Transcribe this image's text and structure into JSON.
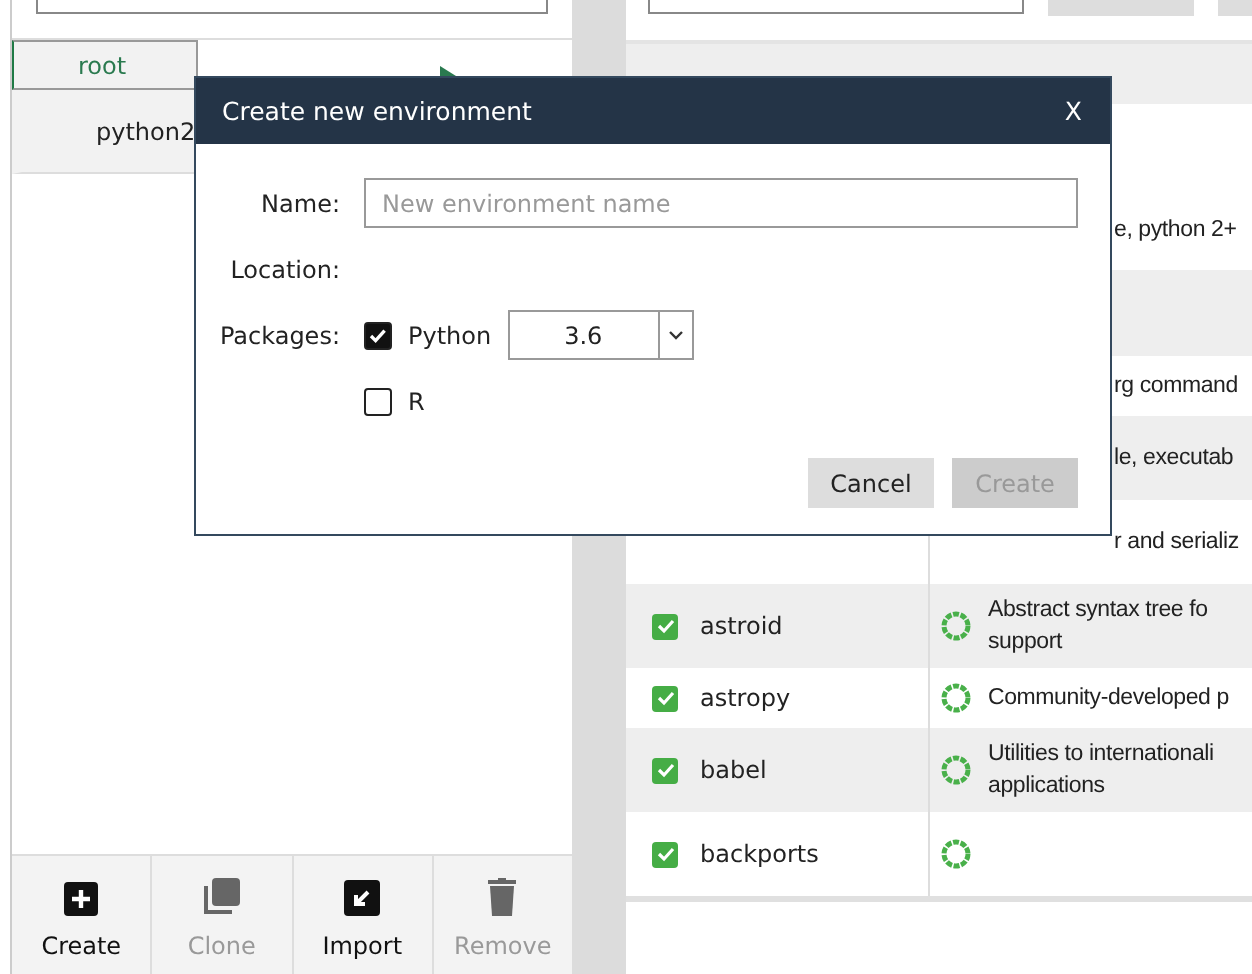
{
  "environments": [
    {
      "name": "root",
      "selected": true
    },
    {
      "name": "python2",
      "selected": false
    }
  ],
  "toolbar": [
    {
      "label": "Create",
      "disabled": false
    },
    {
      "label": "Clone",
      "disabled": true
    },
    {
      "label": "Import",
      "disabled": false
    },
    {
      "label": "Remove",
      "disabled": true
    }
  ],
  "table": {
    "rows": [
      {
        "kind": "covered",
        "description": [
          "e, python 2+"
        ]
      },
      {
        "kind": "covered",
        "description": []
      },
      {
        "kind": "covered",
        "description": [
          "rg command"
        ]
      },
      {
        "kind": "covered",
        "description": [
          "le, executab"
        ]
      },
      {
        "kind": "covered",
        "description": [
          "r and serializ"
        ]
      },
      {
        "kind": "full",
        "name": "astroid",
        "checked": true,
        "description": [
          "Abstract syntax tree fo",
          "support"
        ]
      },
      {
        "kind": "full",
        "name": "astropy",
        "checked": true,
        "description": [
          "Community-developed p"
        ]
      },
      {
        "kind": "full",
        "name": "babel",
        "checked": true,
        "description": [
          "Utilities to internationali",
          "applications"
        ]
      },
      {
        "kind": "full",
        "name": "backports",
        "checked": true,
        "description": []
      }
    ]
  },
  "dialog": {
    "title": "Create new environment",
    "close": "X",
    "name_label": "Name:",
    "name_placeholder": "New environment name",
    "location_label": "Location:",
    "packages_label": "Packages:",
    "packages": [
      {
        "kind": "select",
        "label": "Python",
        "checked": true,
        "version": "3.6"
      },
      {
        "kind": "plain",
        "label": "R",
        "checked": false
      }
    ],
    "buttons": [
      {
        "label": "Cancel",
        "disabled": false
      },
      {
        "label": "Create",
        "disabled": true
      }
    ]
  }
}
